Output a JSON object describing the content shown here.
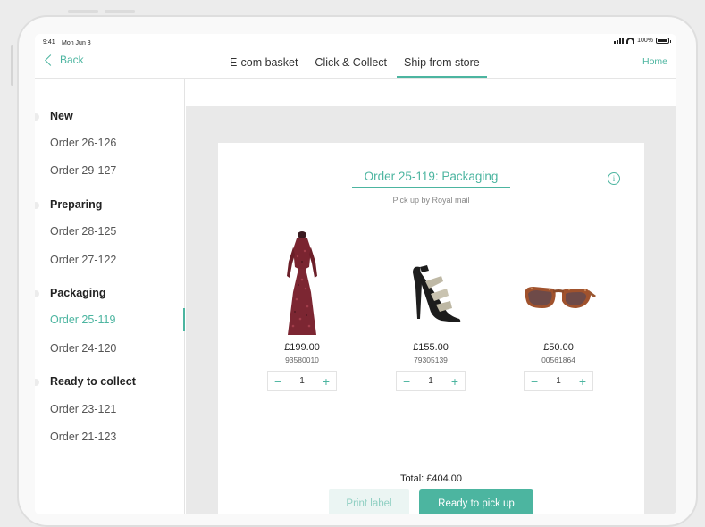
{
  "status": {
    "time": "9:41",
    "date": "Mon Jun 3",
    "battery": "100%"
  },
  "nav": {
    "back_label": "Back",
    "home_label": "Home",
    "tabs": [
      {
        "label": "E-com basket",
        "active": false
      },
      {
        "label": "Click & Collect",
        "active": false
      },
      {
        "label": "Ship from store",
        "active": true
      }
    ]
  },
  "sidebar": {
    "sections": [
      {
        "title": "New",
        "items": [
          {
            "label": "Order 26-126"
          },
          {
            "label": "Order 29-127"
          }
        ]
      },
      {
        "title": "Preparing",
        "items": [
          {
            "label": "Order 28-125"
          },
          {
            "label": "Order 27-122"
          }
        ]
      },
      {
        "title": "Packaging",
        "items": [
          {
            "label": "Order 25-119",
            "active": true
          },
          {
            "label": "Order 24-120"
          }
        ]
      },
      {
        "title": "Ready to collect",
        "items": [
          {
            "label": "Order 23-121"
          },
          {
            "label": "Order 21-123"
          }
        ]
      }
    ]
  },
  "order": {
    "title": "Order 25-119: Packaging",
    "subtitle": "Pick up by Royal mail",
    "info_icon": "i",
    "products": [
      {
        "type": "dress",
        "price": "£199.00",
        "sku": "93580010",
        "qty": "1"
      },
      {
        "type": "heels",
        "price": "£155.00",
        "sku": "79305139",
        "qty": "1"
      },
      {
        "type": "sunglasses",
        "price": "£50.00",
        "sku": "00561864",
        "qty": "1"
      }
    ],
    "stepper_minus": "−",
    "stepper_plus": "+",
    "total": "Total: £404.00",
    "print_label": "Print label",
    "ready_label": "Ready to pick up"
  },
  "colors": {
    "accent": "#4cb5a0",
    "accent_light": "#ebf5f3",
    "background": "#e9e9e9"
  },
  "icons": [
    "back-chevron-icon",
    "info-icon",
    "signal-icon",
    "wifi-icon",
    "battery-icon"
  ]
}
